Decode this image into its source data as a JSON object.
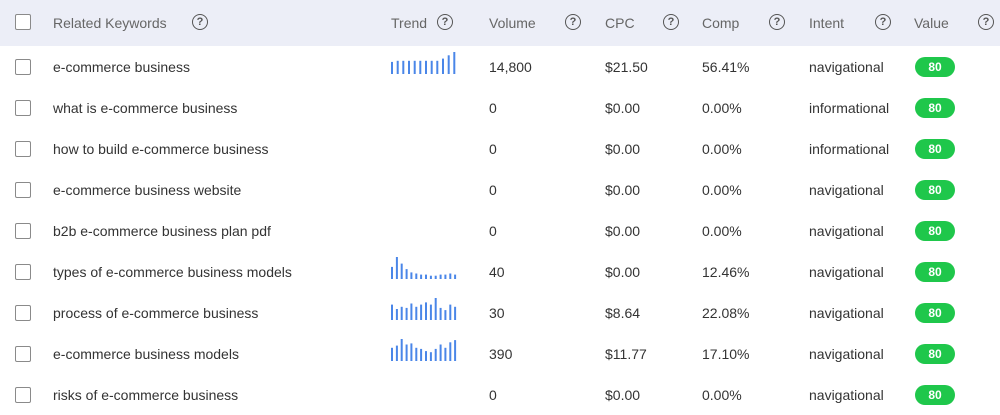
{
  "columns": {
    "keyword": "Related Keywords",
    "trend": "Trend",
    "volume": "Volume",
    "cpc": "CPC",
    "comp": "Comp",
    "intent": "Intent",
    "value": "Value",
    "help_glyph": "?"
  },
  "colors": {
    "bar": "#4a86e8",
    "badge": "#1fc74b",
    "header_bg": "#eceef7"
  },
  "rows": [
    {
      "keyword": "e-commerce business",
      "volume": "14,800",
      "cpc": "$21.50",
      "comp": "56.41%",
      "intent": "navigational",
      "value": "80",
      "trend": [
        0.55,
        0.6,
        0.6,
        0.6,
        0.6,
        0.6,
        0.6,
        0.6,
        0.6,
        0.7,
        0.85,
        1.0
      ]
    },
    {
      "keyword": "what is e-commerce business",
      "volume": "0",
      "cpc": "$0.00",
      "comp": "0.00%",
      "intent": "informational",
      "value": "80",
      "trend": []
    },
    {
      "keyword": "how to build e-commerce business",
      "volume": "0",
      "cpc": "$0.00",
      "comp": "0.00%",
      "intent": "informational",
      "value": "80",
      "trend": []
    },
    {
      "keyword": "e-commerce business website",
      "volume": "0",
      "cpc": "$0.00",
      "comp": "0.00%",
      "intent": "navigational",
      "value": "80",
      "trend": []
    },
    {
      "keyword": "b2b e-commerce business plan pdf",
      "volume": "0",
      "cpc": "$0.00",
      "comp": "0.00%",
      "intent": "navigational",
      "value": "80",
      "trend": []
    },
    {
      "keyword": "types of e-commerce business models",
      "volume": "40",
      "cpc": "$0.00",
      "comp": "12.46%",
      "intent": "navigational",
      "value": "80",
      "trend": [
        0.55,
        1.0,
        0.7,
        0.45,
        0.3,
        0.25,
        0.2,
        0.2,
        0.15,
        0.15,
        0.2,
        0.2,
        0.25,
        0.2
      ]
    },
    {
      "keyword": "process of e-commerce business",
      "volume": "30",
      "cpc": "$8.64",
      "comp": "22.08%",
      "intent": "navigational",
      "value": "80",
      "trend": [
        0.7,
        0.5,
        0.6,
        0.55,
        0.75,
        0.6,
        0.7,
        0.8,
        0.7,
        1.0,
        0.55,
        0.45,
        0.7,
        0.6
      ]
    },
    {
      "keyword": "e-commerce business models",
      "volume": "390",
      "cpc": "$11.77",
      "comp": "17.10%",
      "intent": "navigational",
      "value": "80",
      "trend": [
        0.6,
        0.7,
        1.0,
        0.75,
        0.8,
        0.6,
        0.55,
        0.45,
        0.4,
        0.55,
        0.75,
        0.6,
        0.85,
        0.95
      ]
    },
    {
      "keyword": "risks of e-commerce business",
      "volume": "0",
      "cpc": "$0.00",
      "comp": "0.00%",
      "intent": "navigational",
      "value": "80",
      "trend": []
    }
  ]
}
